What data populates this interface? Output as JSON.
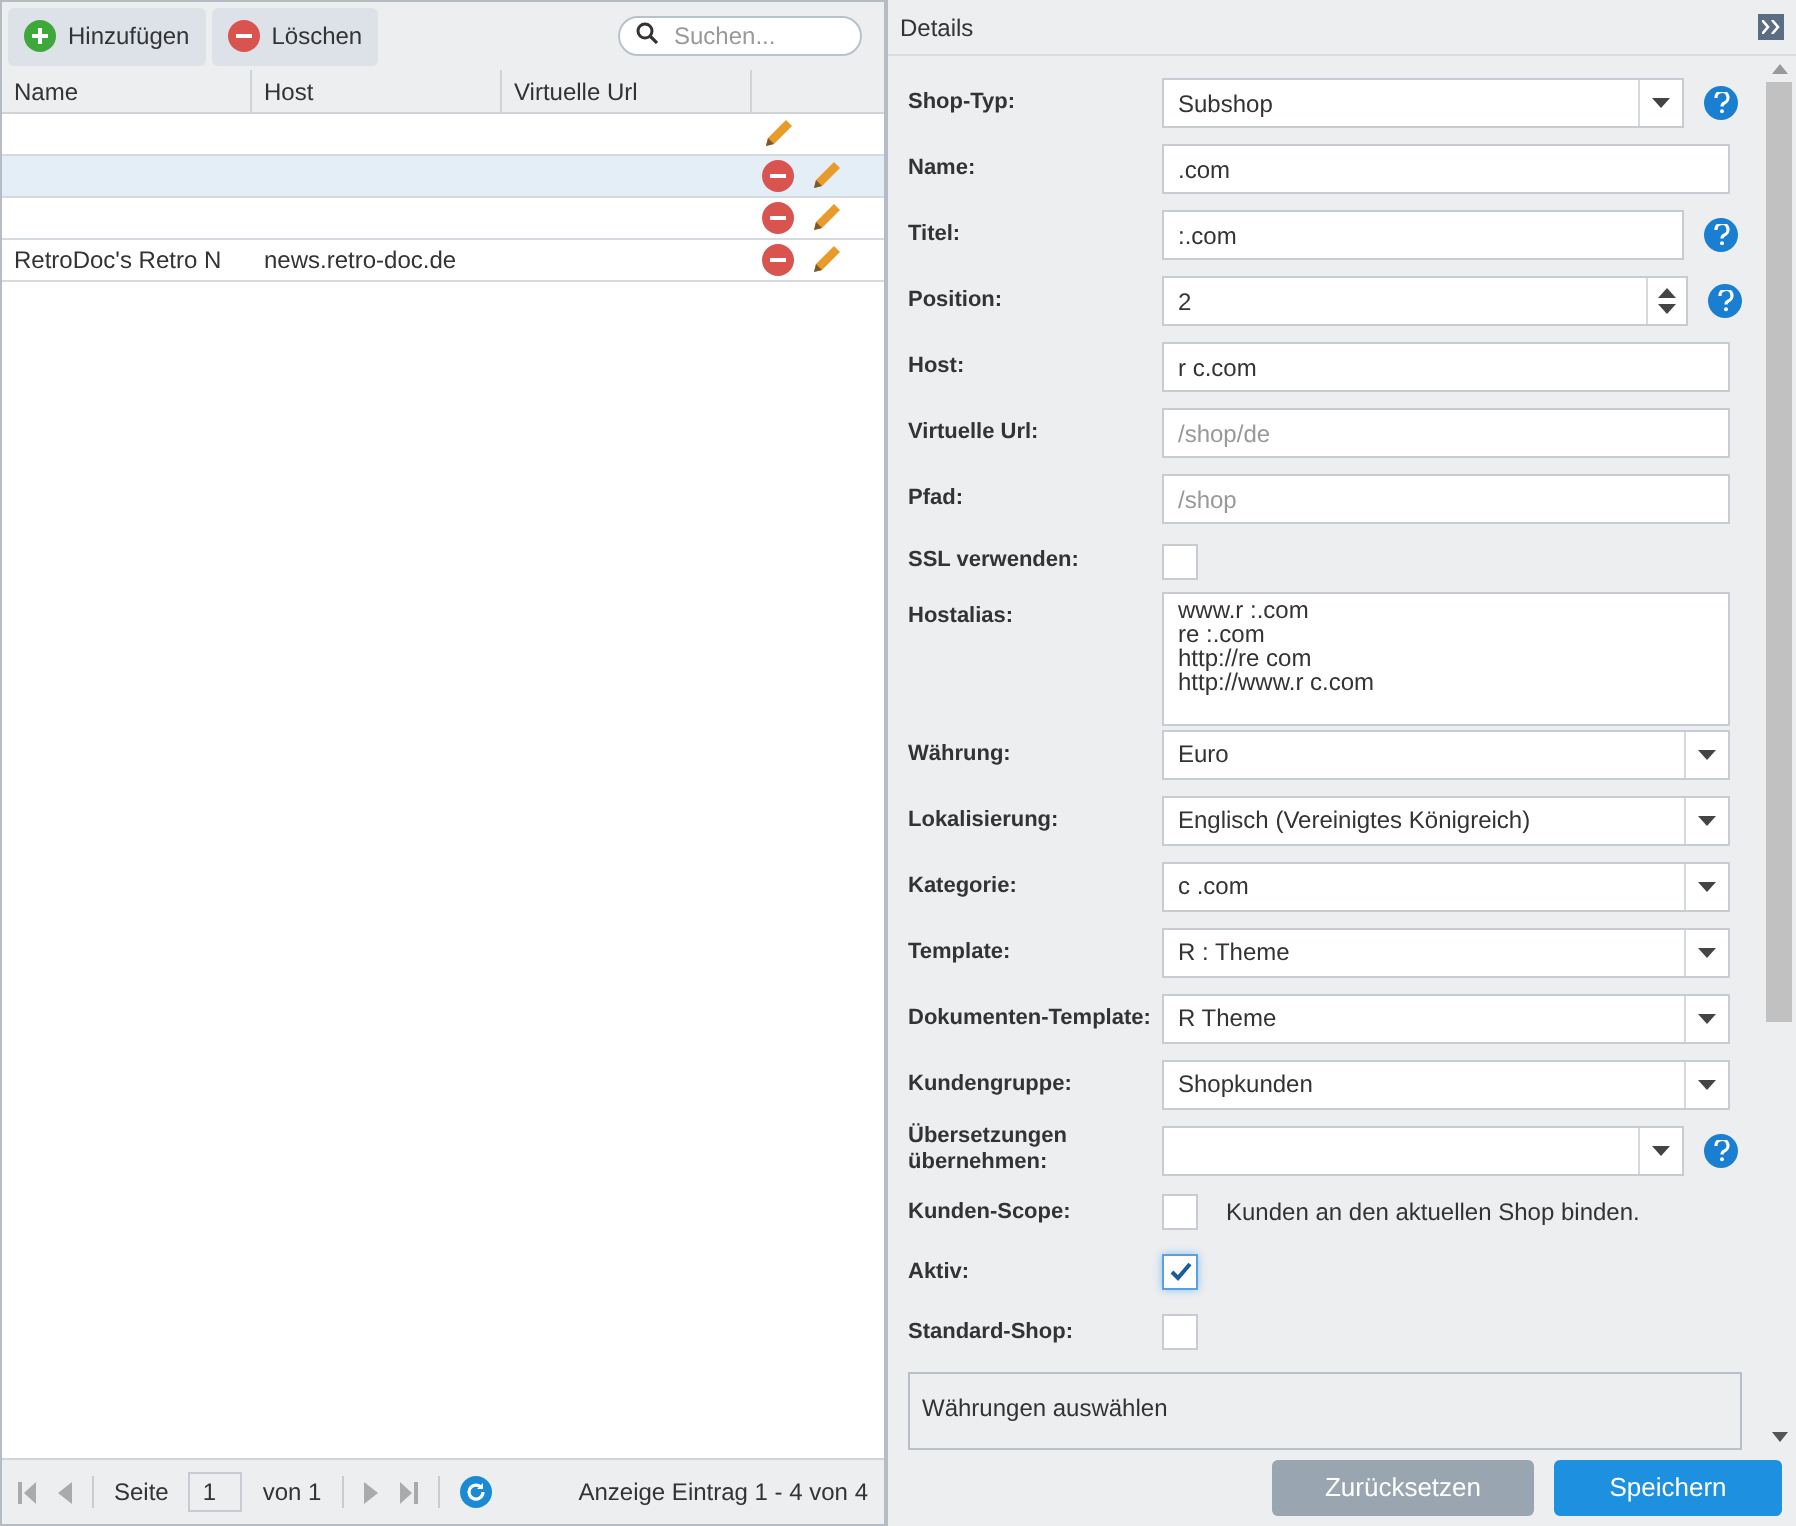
{
  "toolbar": {
    "buttons": [
      {
        "label": "Hinzufügen",
        "kind": "add"
      },
      {
        "label": "Löschen",
        "kind": "delete"
      }
    ],
    "search": {
      "placeholder": "Suchen..."
    }
  },
  "table": {
    "columns": [
      "Name",
      "Host",
      "Virtuelle Url"
    ],
    "rows": [
      {
        "cells": [
          "",
          "",
          ""
        ],
        "deletable": false,
        "selected": false
      },
      {
        "cells": [
          "",
          "",
          ""
        ],
        "deletable": true,
        "selected": true
      },
      {
        "cells": [
          "",
          "",
          ""
        ],
        "deletable": true,
        "selected": false
      },
      {
        "cells": [
          "RetroDoc's Retro N",
          "news.retro-doc.de",
          ""
        ],
        "deletable": true,
        "selected": false
      }
    ]
  },
  "pager": {
    "page_label": "Seite",
    "page": "1",
    "of": "von 1",
    "summary": "Anzeige Eintrag 1 - 4 von 4"
  },
  "details": {
    "title": "Details",
    "fields": [
      {
        "label": "Shop-Typ:",
        "kind": "combo",
        "value": "Subshop",
        "help": true
      },
      {
        "label": "Name:",
        "kind": "text",
        "value": ".com",
        "help": false
      },
      {
        "label": "Titel:",
        "kind": "text",
        "value": ":.com",
        "help": true
      },
      {
        "label": "Position:",
        "kind": "number",
        "value": "2",
        "help": true
      },
      {
        "label": "Host:",
        "kind": "text",
        "value": "r c.com",
        "help": false
      },
      {
        "label": "Virtuelle Url:",
        "kind": "text",
        "placeholder": "/shop/de",
        "help": false
      },
      {
        "label": "Pfad:",
        "kind": "text",
        "placeholder": "/shop",
        "help": false
      },
      {
        "label": "SSL verwenden:",
        "kind": "checkbox",
        "checked": false,
        "help": false
      },
      {
        "label": "Hostalias:",
        "kind": "textarea",
        "lines": [
          "www.r :.com",
          "re :.com",
          "http://re com",
          "http://www.r c.com"
        ],
        "help": false
      },
      {
        "label": "Währung:",
        "kind": "combo",
        "value": "Euro",
        "help": false
      },
      {
        "label": "Lokalisierung:",
        "kind": "combo",
        "value": "Englisch (Vereinigtes Königreich)",
        "help": false
      },
      {
        "label": "Kategorie:",
        "kind": "combo",
        "value": "c .com",
        "help": false
      },
      {
        "label": "Template:",
        "kind": "combo",
        "value": "R : Theme",
        "help": false
      },
      {
        "label": "Dokumenten-Template:",
        "kind": "combo",
        "value": "R Theme",
        "help": false
      },
      {
        "label": "Kundengruppe:",
        "kind": "combo",
        "value": "Shopkunden",
        "help": false
      },
      {
        "label": "Übersetzungen übernehmen:",
        "kind": "combo",
        "help": true
      },
      {
        "label": "Kunden-Scope:",
        "kind": "checkbox",
        "checked": false,
        "text": "Kunden an den aktuellen Shop binden.",
        "help": false
      },
      {
        "label": "Aktiv:",
        "kind": "checkbox",
        "checked": true,
        "help": false
      },
      {
        "label": "Standard-Shop:",
        "kind": "checkbox",
        "checked": false,
        "help": false
      }
    ],
    "section": "Währungen auswählen",
    "buttons": [
      {
        "label": "Zurücksetzen",
        "kind": "secondary"
      },
      {
        "label": "Speichern",
        "kind": "primary"
      }
    ]
  }
}
